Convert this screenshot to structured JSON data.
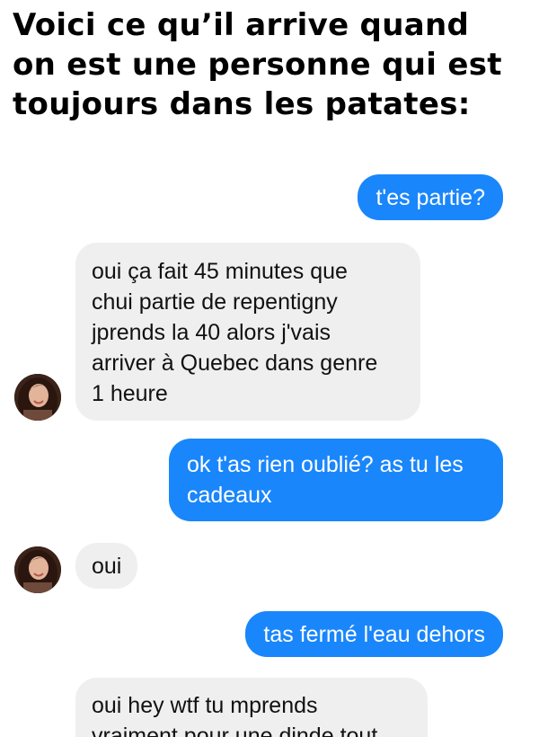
{
  "title_lines": [
    "Voici ce qu’il arrive quand",
    "on est une personne qui est",
    "toujours dans les patates:"
  ],
  "messages": [
    {
      "sender": "me",
      "lines": [
        "t'es partie?"
      ]
    },
    {
      "sender": "contact",
      "lines": [
        "oui ça fait 45 minutes que",
        "chui partie de repentigny",
        "jprends la 40 alors j'vais",
        "arriver à Quebec dans genre",
        "1 heure"
      ]
    },
    {
      "sender": "me",
      "lines": [
        "ok t'as rien oublié? as tu les",
        "cadeaux"
      ]
    },
    {
      "sender": "contact",
      "lines": [
        "oui"
      ]
    },
    {
      "sender": "me",
      "lines": [
        "tas fermé l'eau dehors"
      ]
    },
    {
      "sender": "contact",
      "lines": [
        "oui hey wtf tu mprends",
        "vraiment pour une dinde tout"
      ]
    }
  ],
  "colors": {
    "outgoing_bubble": "#1a86fb",
    "incoming_bubble": "#efefef"
  },
  "icons": {
    "avatar": "contact-profile-photo"
  }
}
